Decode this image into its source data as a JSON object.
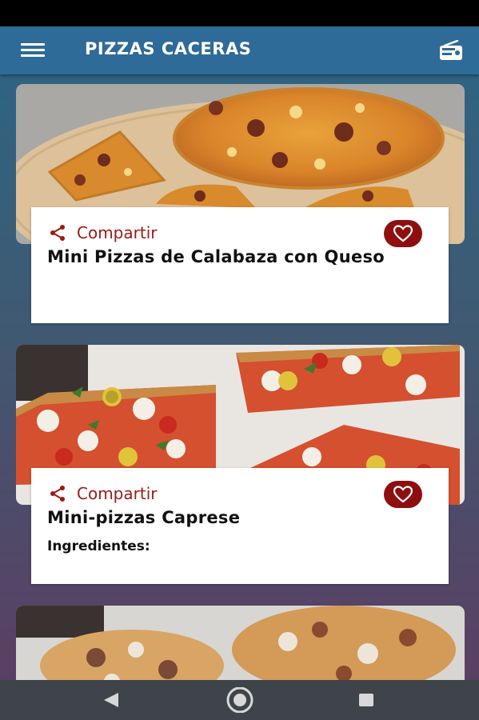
{
  "app_bar": {
    "title": "PIZZAS CACERAS",
    "menu_icon": "hamburger-menu-icon",
    "radio_icon": "radio-icon",
    "background": "#2e6b98"
  },
  "recipes": [
    {
      "share_label": "Compartir",
      "title": "Mini Pizzas de Calabaza con Queso",
      "subtitle": "",
      "favorite_icon": "heart-outline-icon"
    },
    {
      "share_label": "Compartir",
      "title": "Mini-pizzas Caprese",
      "subtitle": "Ingredientes:",
      "favorite_icon": "heart-outline-icon"
    }
  ],
  "colors": {
    "accent": "#9a1a14",
    "favorite_bg": "#8e0f10",
    "nav_bar": "#3e4449"
  },
  "nav_bar": {
    "back_icon": "back-triangle-icon",
    "home_icon": "home-circle-icon",
    "recents_icon": "recents-square-icon"
  }
}
